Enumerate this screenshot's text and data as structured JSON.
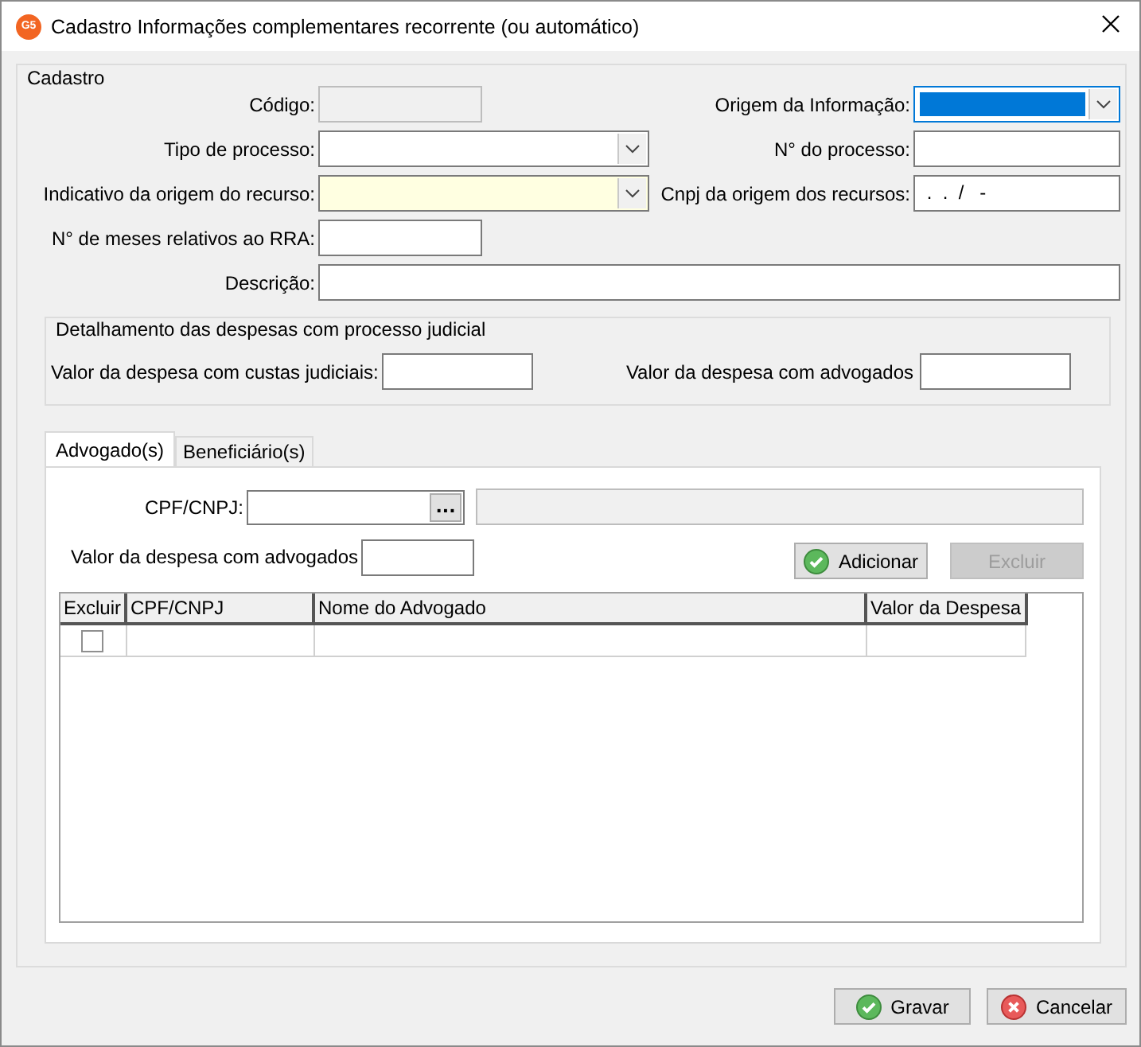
{
  "window": {
    "logo": "G5",
    "title": "Cadastro Informações complementares recorrente (ou automático)"
  },
  "cadastro": {
    "title": "Cadastro",
    "rows": [
      {
        "left": {
          "label": "Código:",
          "kind": "short",
          "disabled": true
        },
        "right": {
          "label": "Origem da Informação:",
          "kind": "combo",
          "focused": true
        }
      },
      {
        "left": {
          "label": "Tipo de processo:",
          "kind": "combo"
        },
        "right": {
          "label": "N° do processo:",
          "kind": "text"
        }
      },
      {
        "left": {
          "label": "Indicativo da origem do recurso:",
          "kind": "combo",
          "required": true
        },
        "right": {
          "label": "Cnpj da origem dos recursos:",
          "kind": "text",
          "value": " .  .  /   -"
        }
      },
      {
        "left": {
          "label": "N° de meses relativos ao RRA:",
          "kind": "short"
        }
      },
      {
        "full": {
          "label": "Descrição:",
          "kind": "text"
        }
      }
    ]
  },
  "detalhamento": {
    "title": "Detalhamento das despesas com processo judicial",
    "fields": [
      {
        "label": "Valor da despesa com custas judiciais:"
      },
      {
        "label": "Valor da despesa com advogados"
      }
    ]
  },
  "tabs": [
    {
      "label": "Advogado(s)",
      "selected": true
    },
    {
      "label": "Beneficiário(s)",
      "selected": false
    }
  ],
  "panel": {
    "cpf": {
      "label": "CPF/CNPJ:",
      "button": "..."
    },
    "valor": {
      "label": "Valor da despesa com advogados"
    },
    "buttons": [
      {
        "label": "Adicionar",
        "kind": "ok",
        "disabled": false
      },
      {
        "label": "Excluir",
        "kind": "none",
        "disabled": true
      }
    ],
    "table": {
      "columns": [
        "Excluir",
        "CPF/CNPJ",
        "Nome do Advogado",
        "Valor da Despesa"
      ],
      "rows": [
        {
          "checked": false
        }
      ]
    }
  },
  "footer": {
    "buttons": [
      {
        "label": "Gravar",
        "kind": "ok",
        "disabled": false
      },
      {
        "label": "Cancelar",
        "kind": "cancel",
        "disabled": false
      }
    ]
  }
}
